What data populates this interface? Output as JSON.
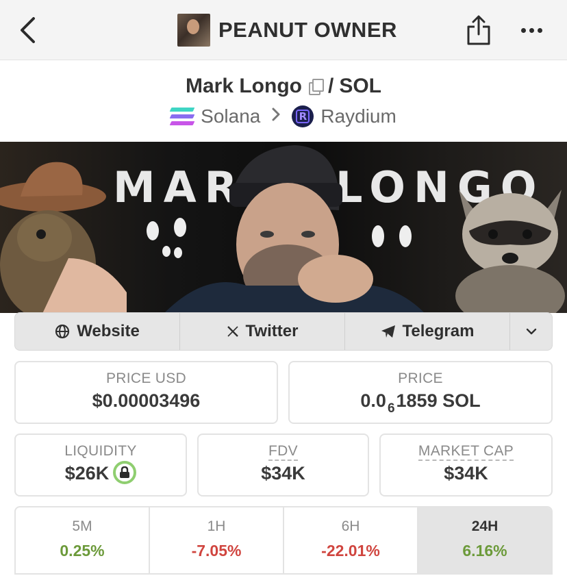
{
  "header": {
    "title": "PEANUT OWNER"
  },
  "pair": {
    "base": "Mark Longo",
    "separator": "/",
    "quote": "SOL",
    "chain": "Solana",
    "dex": "Raydium"
  },
  "banner": {
    "left_text": "MARK",
    "right_text": "LONGO"
  },
  "links": [
    {
      "label": "Website",
      "icon": "globe-icon"
    },
    {
      "label": "Twitter",
      "icon": "x-icon"
    },
    {
      "label": "Telegram",
      "icon": "telegram-icon"
    }
  ],
  "stats": {
    "price_usd_label": "PRICE USD",
    "price_usd_value": "$0.00003496",
    "price_label": "PRICE",
    "price_prefix": "0.0",
    "price_subscript": "6",
    "price_suffix": "1859 SOL",
    "liquidity_label": "LIQUIDITY",
    "liquidity_value": "$26K",
    "fdv_label": "FDV",
    "fdv_value": "$34K",
    "mcap_label": "MARKET CAP",
    "mcap_value": "$34K"
  },
  "timeframes": [
    {
      "label": "5M",
      "value": "0.25%",
      "direction": "up"
    },
    {
      "label": "1H",
      "value": "-7.05%",
      "direction": "down"
    },
    {
      "label": "6H",
      "value": "-22.01%",
      "direction": "down"
    },
    {
      "label": "24H",
      "value": "6.16%",
      "direction": "up",
      "active": true
    }
  ],
  "colors": {
    "positive": "#6c9a3a",
    "negative": "#d0453f",
    "lock_green": "#8fce70"
  }
}
